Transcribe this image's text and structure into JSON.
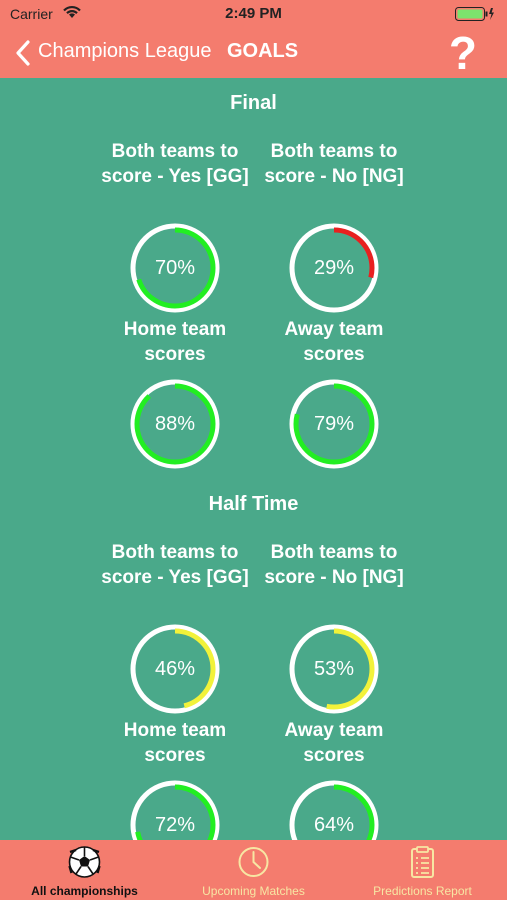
{
  "status_bar": {
    "carrier": "Carrier",
    "time": "2:49 PM"
  },
  "nav": {
    "back_label": "Champions League",
    "title": "GOALS",
    "help_label": "?"
  },
  "sections": [
    {
      "title": "Final",
      "items": [
        {
          "label": "Both teams to score - Yes [GG]",
          "percent": 70,
          "value_text": "70%",
          "color": "#22ee22"
        },
        {
          "label": "Both teams to score - No [NG]",
          "percent": 29,
          "value_text": "29%",
          "color": "#e82020"
        },
        {
          "label": "Home team scores",
          "percent": 88,
          "value_text": "88%",
          "color": "#22ee22"
        },
        {
          "label": "Away team scores",
          "percent": 79,
          "value_text": "79%",
          "color": "#22ee22"
        }
      ]
    },
    {
      "title": "Half Time",
      "items": [
        {
          "label": "Both teams to score - Yes [GG]",
          "percent": 46,
          "value_text": "46%",
          "color": "#f2f23a"
        },
        {
          "label": "Both teams to score - No [NG]",
          "percent": 53,
          "value_text": "53%",
          "color": "#f2f23a"
        },
        {
          "label": "Home team scores",
          "percent": 72,
          "value_text": "72%",
          "color": "#22ee22"
        },
        {
          "label": "Away team scores",
          "percent": 64,
          "value_text": "64%",
          "color": "#22ee22"
        }
      ]
    }
  ],
  "tabs": [
    {
      "label": "All championships",
      "icon": "soccer-ball-icon",
      "active": true
    },
    {
      "label": "Upcoming Matches",
      "icon": "clock-icon",
      "active": false
    },
    {
      "label": "Predictions Report",
      "icon": "clipboard-icon",
      "active": false
    }
  ],
  "colors": {
    "background": "#4aa98a",
    "bar": "#f47c6e",
    "ring_track": "#ffffff",
    "tab_inactive": "#f7e6a3"
  }
}
